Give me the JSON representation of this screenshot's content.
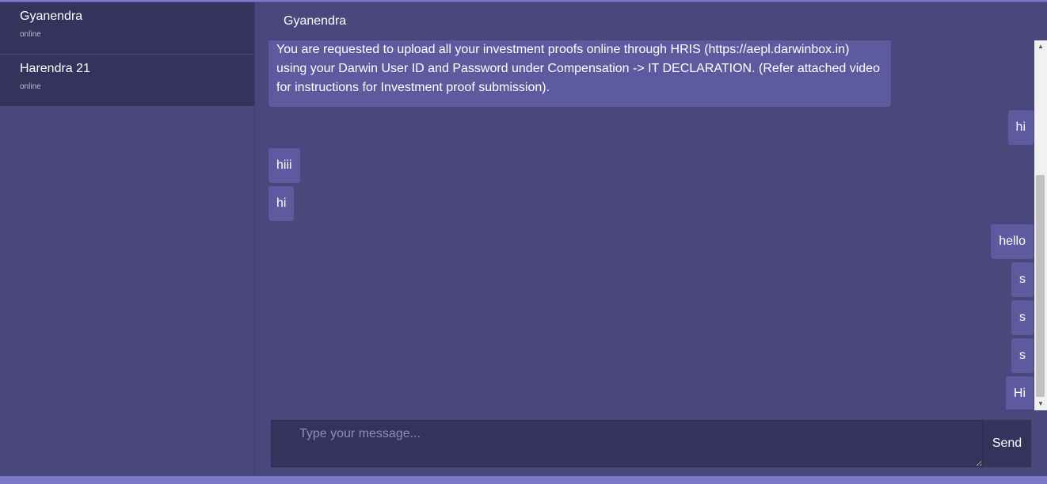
{
  "sidebar": {
    "contacts": [
      {
        "name": "Gyanendra",
        "status": "online"
      },
      {
        "name": "Harendra 21",
        "status": "online"
      }
    ]
  },
  "chat": {
    "title": "Gyanendra",
    "messages": [
      {
        "direction": "in",
        "text": "You are requested to upload all your investment proofs online through HRIS (https://aepl.darwinbox.in) using your Darwin User ID and Password under Compensation -> IT DECLARATION. (Refer attached video for instructions for Investment proof submission)."
      },
      {
        "direction": "out",
        "text": "hi"
      },
      {
        "direction": "in",
        "text": "hiii"
      },
      {
        "direction": "in",
        "text": "hi"
      },
      {
        "direction": "out",
        "text": "hello"
      },
      {
        "direction": "out",
        "text": "s"
      },
      {
        "direction": "out",
        "text": "s"
      },
      {
        "direction": "out",
        "text": "s"
      },
      {
        "direction": "out",
        "text": "Hi"
      }
    ]
  },
  "composer": {
    "placeholder": "Type your message...",
    "value": "",
    "send_label": "Send"
  },
  "colors": {
    "background": "#4a477c",
    "contact_bg": "#35335b",
    "bubble": "#5d5aa0",
    "accent_bar": "#7b79c9"
  }
}
